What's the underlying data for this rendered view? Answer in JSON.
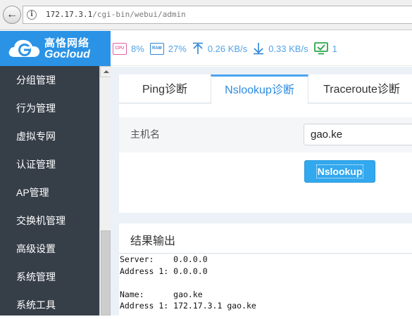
{
  "browser": {
    "back_icon": "back-arrow-icon",
    "url_host": "172.17.3.1",
    "url_path": "/cgi-bin/webui/admin"
  },
  "header": {
    "logo_cn": "高恪网络",
    "logo_en": "Gocloud",
    "brand_color": "#2b93e6",
    "stats": {
      "cpu_label": "CPU",
      "cpu": "8%",
      "ram_label": "RAM",
      "ram": "27%",
      "upload": "0.26 KB/s",
      "download": "0.33 KB/s",
      "online": "1"
    }
  },
  "sidebar": {
    "items": [
      {
        "label": "分组管理"
      },
      {
        "label": "行为管理"
      },
      {
        "label": "虚拟专网"
      },
      {
        "label": "认证管理"
      },
      {
        "label": "AP管理"
      },
      {
        "label": "交换机管理"
      },
      {
        "label": "高级设置"
      },
      {
        "label": "系统管理"
      },
      {
        "label": "系统工具"
      }
    ]
  },
  "tabs": [
    {
      "label": "Ping诊断"
    },
    {
      "label": "Nslookup诊断",
      "active": true
    },
    {
      "label": "Traceroute诊断"
    }
  ],
  "form": {
    "host_label": "主机名",
    "host_value": "gao.ke",
    "submit_label": "Nslookup"
  },
  "result": {
    "title": "结果输出",
    "lines": [
      "Server:    0.0.0.0",
      "Address 1: 0.0.0.0",
      "",
      "Name:      gao.ke",
      "Address 1: 172.17.3.1 gao.ke"
    ]
  }
}
